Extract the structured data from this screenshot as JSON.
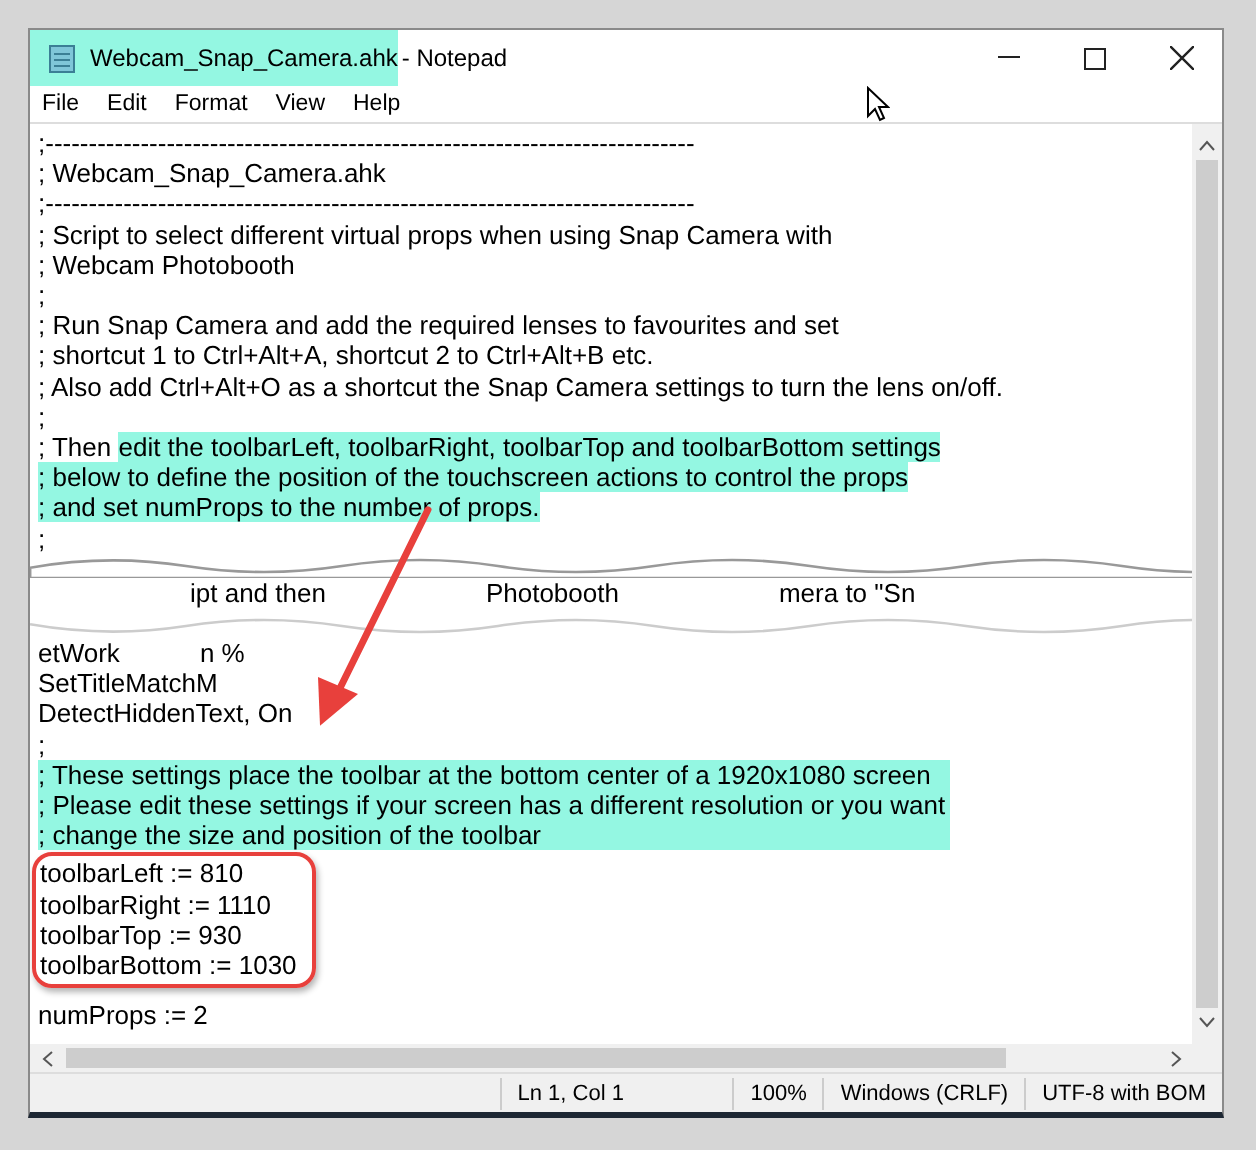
{
  "window": {
    "file_name": "Webcam_Snap_Camera.ahk",
    "file_name_highlighted": true,
    "app_name": " - Notepad"
  },
  "menu": [
    "File",
    "Edit",
    "Format",
    "View",
    "Help"
  ],
  "lines_before_tear": [
    {
      "segments": [
        {
          "text": ";---------------------------------------------------------------------------",
          "highlighted": false
        }
      ]
    },
    {
      "segments": [
        {
          "text": "; Webcam_Snap_Camera.ahk",
          "highlighted": false
        }
      ]
    },
    {
      "segments": [
        {
          "text": ";---------------------------------------------------------------------------",
          "highlighted": false
        }
      ]
    },
    {
      "segments": [
        {
          "text": "; Script to select different virtual props when using Snap Camera with",
          "highlighted": false
        }
      ]
    },
    {
      "segments": [
        {
          "text": "; Webcam Photobooth",
          "highlighted": false
        }
      ]
    },
    {
      "segments": [
        {
          "text": ";",
          "highlighted": false
        }
      ]
    },
    {
      "segments": [
        {
          "text": "; Run Snap Camera and add the required lenses to favourites and set",
          "highlighted": false
        }
      ]
    },
    {
      "segments": [
        {
          "text": "; shortcut 1 to Ctrl+Alt+A, shortcut 2 to Ctrl+Alt+B etc.",
          "highlighted": false
        }
      ]
    },
    {
      "segments": [
        {
          "text": "; Also add Ctrl+Alt+O as a shortcut the Snap Camera settings to turn the lens on/off.",
          "highlighted": false
        }
      ]
    },
    {
      "segments": [
        {
          "text": ";",
          "highlighted": false
        }
      ]
    },
    {
      "segments": [
        {
          "text": "; Then ",
          "highlighted": false
        },
        {
          "text": "edit the toolbarLeft, toolbarRight, toolbarTop and toolbarBottom settings",
          "highlighted": true
        }
      ]
    },
    {
      "segments": [
        {
          "text": "; below to define the position of the touchscreen actions to control the props",
          "highlighted": true
        }
      ]
    },
    {
      "segments": [
        {
          "text": "; and set numProps to the number of props.",
          "highlighted": true
        }
      ]
    },
    {
      "segments": [
        {
          "text": ";",
          "highlighted": false
        }
      ]
    }
  ],
  "tear_fragments": [
    "ipt and then",
    "Photobooth",
    "mera to \"Sn"
  ],
  "lines_after_tear": [
    {
      "segments": [
        {
          "text": "etWork",
          "highlighted": false
        }
      ],
      "fragment_tail": "n %"
    },
    {
      "segments": [
        {
          "text": "SetTitleMatchM",
          "highlighted": false
        }
      ]
    },
    {
      "segments": [
        {
          "text": "DetectHiddenText, On",
          "highlighted": false
        }
      ]
    },
    {
      "segments": [
        {
          "text": ";",
          "highlighted": false
        }
      ]
    },
    {
      "segments": [
        {
          "text": "; These settings place the toolbar at the bottom center of a 1920x1080 screen",
          "highlighted": true
        }
      ]
    },
    {
      "segments": [
        {
          "text": "; Please edit these settings if your screen has a different resolution or you want",
          "highlighted": true
        }
      ]
    },
    {
      "segments": [
        {
          "text": "; change the size and position of the toolbar",
          "highlighted": true
        }
      ]
    }
  ],
  "circled_lines": [
    "toolbarLeft := 810",
    "toolbarRight := 1110",
    "toolbarTop := 930",
    "toolbarBottom := 1030"
  ],
  "last_lines": [
    "numProps := 2"
  ],
  "status_bar": [
    "Ln 1, Col 1",
    "100%",
    "Windows (CRLF)",
    "UTF-8 with BOM"
  ]
}
